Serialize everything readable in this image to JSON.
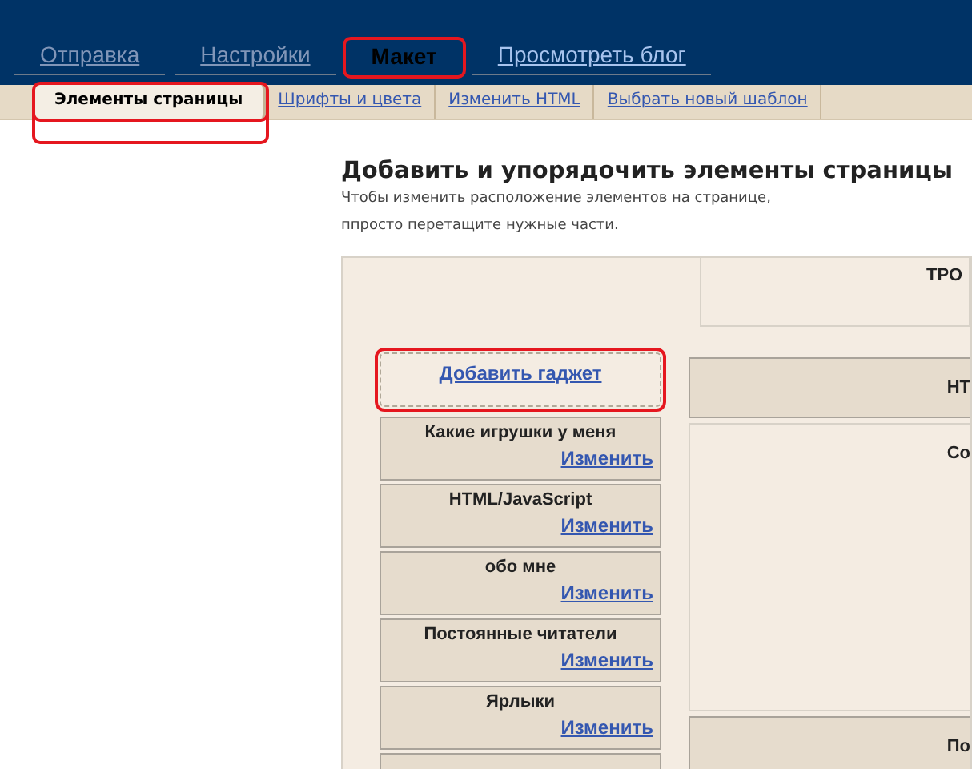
{
  "tabs": [
    {
      "label": "Отправка",
      "selected": false,
      "highlighted": false
    },
    {
      "label": "Настройки",
      "selected": false,
      "highlighted": false
    },
    {
      "label": "Макет",
      "selected": true,
      "highlighted": true
    },
    {
      "label": "Просмотреть блог",
      "selected": false,
      "highlighted": false
    }
  ],
  "subtabs": [
    {
      "label": "Элементы страницы",
      "selected": true,
      "highlighted": true
    },
    {
      "label": "Шрифты и цвета",
      "selected": false,
      "highlighted": false
    },
    {
      "label": "Изменить HTML",
      "selected": false,
      "highlighted": false
    },
    {
      "label": "Выбрать новый шаблон",
      "selected": false,
      "highlighted": false
    }
  ],
  "heading": "Добавить и упорядочить элементы страницы",
  "description": "Чтобы изменить расположение элементов на странице, ппросто перетащите нужные части.",
  "layout": {
    "header": "ТРО",
    "add_gadget": {
      "label": "Добавить гаджет",
      "highlighted": true
    },
    "sidebar_gadgets": [
      {
        "title": "Какие игрушки у меня",
        "edit": "Изменить"
      },
      {
        "title": "HTML/JavaScript",
        "edit": "Изменить"
      },
      {
        "title": "обо мне",
        "edit": "Изменить"
      },
      {
        "title": "Постоянные читатели",
        "edit": "Изменить"
      },
      {
        "title": "Ярлыки",
        "edit": "Изменить"
      }
    ],
    "main_column": [
      {
        "kind": "gadget",
        "title": "НТ"
      },
      {
        "kind": "posts",
        "title": "Со"
      },
      {
        "kind": "gadget",
        "title": "По"
      }
    ]
  }
}
